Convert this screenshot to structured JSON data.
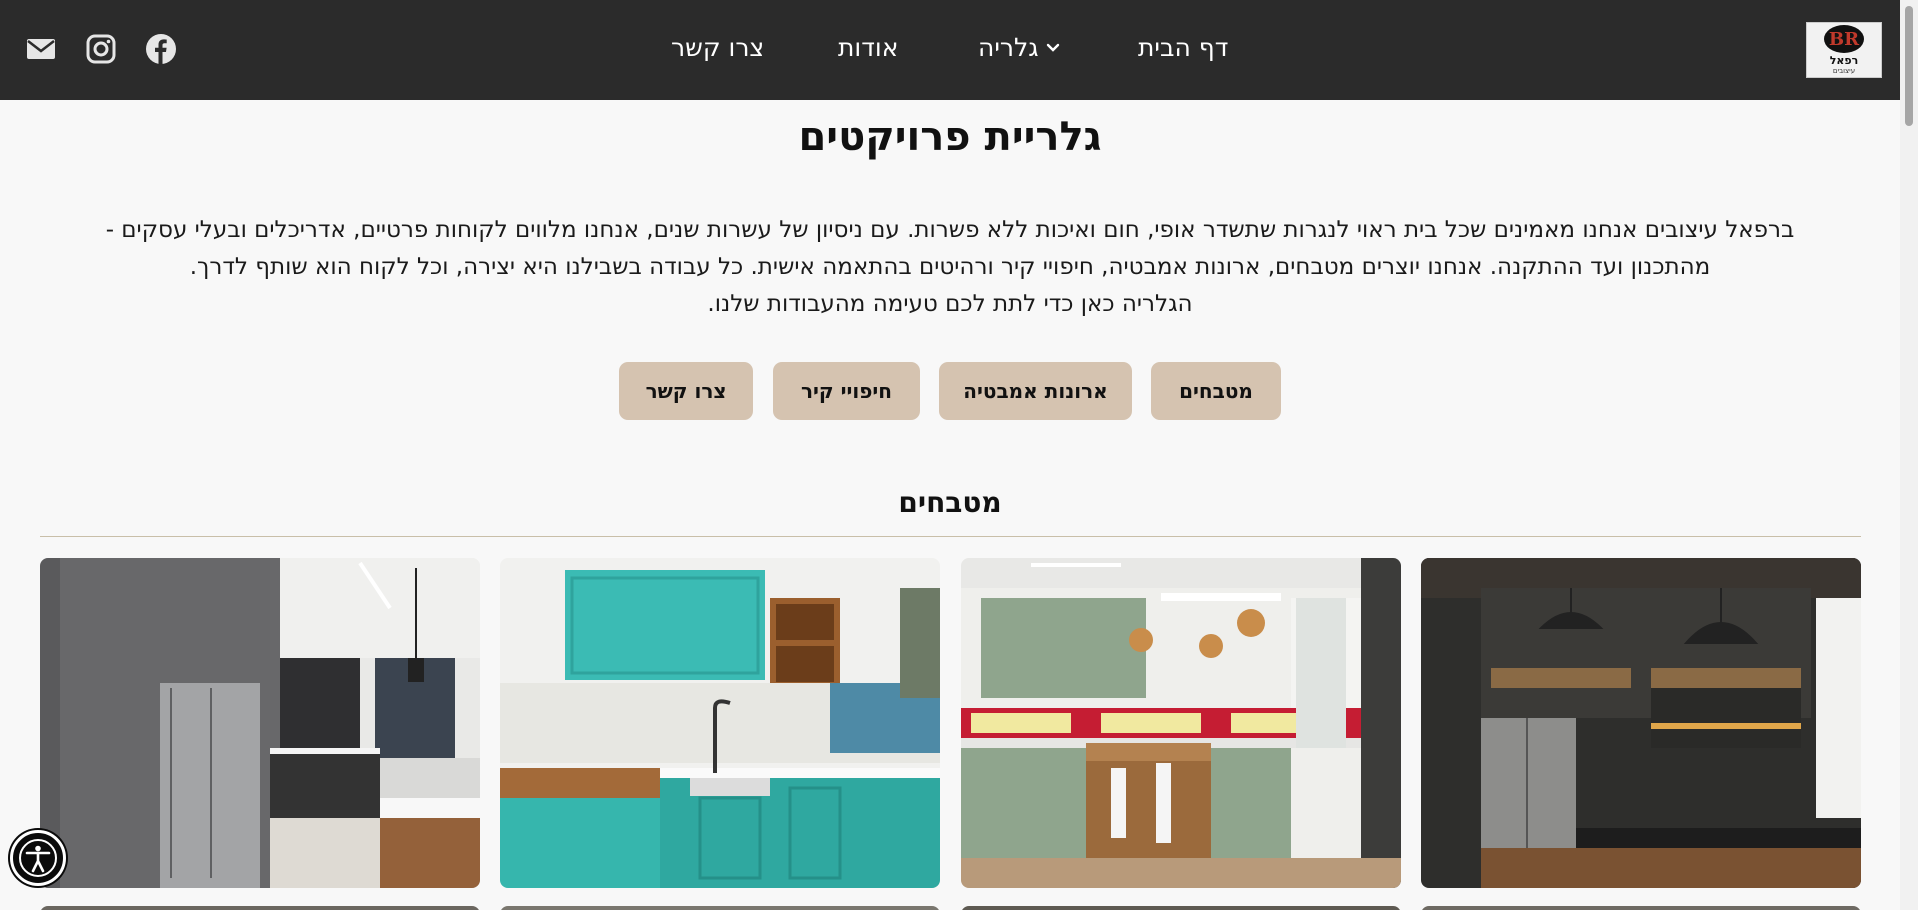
{
  "header": {
    "nav": {
      "home": "דף הבית",
      "gallery": "גלריה",
      "about": "אודות",
      "contact": "צרו קשר"
    },
    "logo": {
      "mark": "BR",
      "name": "רפאל",
      "sub": "עיצובים"
    },
    "social_icons": [
      "email-icon",
      "instagram-icon",
      "facebook-icon"
    ]
  },
  "page": {
    "title": "גלריית פרויקטים",
    "intro": [
      "ברפאל עיצובים אנחנו מאמינים שכל בית ראוי לנגרות שתשדר אופי, חום ואיכות ללא פשרות. עם ניסיון של עשרות שנים, אנחנו מלווים לקוחות פרטיים, אדריכלים ובעלי עסקים -",
      "מהתכנון ועד ההתקנה. אנחנו יוצרים מטבחים, ארונות אמבטיה, חיפויי קיר ורהיטים בהתאמה אישית. כל עבודה בשבילנו היא יצירה, וכל לקוח הוא שותף לדרך.",
      "הגלריה כאן כדי לתת לכם טעימה מהעבודות שלנו."
    ],
    "category_buttons": {
      "kitchens": "מטבחים",
      "bathroom": "ארונות אמבטיה",
      "wall": "חיפויי קיר",
      "contact": "צרו קשר"
    },
    "section_title": "מטבחים"
  },
  "colors": {
    "header_bg": "#2b2b2b",
    "button_bg": "#d5c3b0",
    "divider": "#c9bfa9",
    "page_bg": "#f8f8f8"
  }
}
